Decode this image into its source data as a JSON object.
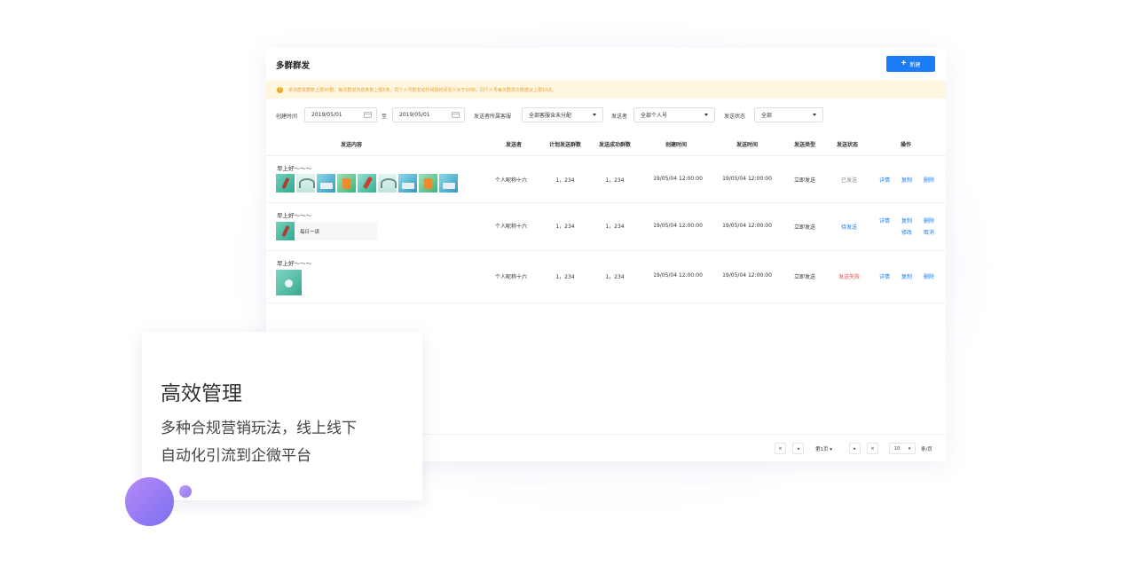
{
  "header": {
    "title": "多群群发",
    "new_button": "新建"
  },
  "notice": "单次群发群数上限30群，每次群发内容条数上限5条。同个人号群发动作间隔时间至少大于30秒，同个人号每天群发次数建议上限10次。",
  "filters": {
    "created_time_label": "创建时间",
    "start_date": "2019/05/01",
    "to_label": "至",
    "end_date": "2019/05/01",
    "service_label": "发送者所属客服",
    "service_value": "全部客服含未分配",
    "sender_label": "发送者",
    "sender_value": "全部个人号",
    "status_label": "发送状态",
    "status_value": "全部"
  },
  "table": {
    "headers": [
      "发送内容",
      "发送者",
      "计划发送群数",
      "发送成功群数",
      "创建时间",
      "发送时间",
      "发送类型",
      "发送状态",
      "操作"
    ],
    "rows": [
      {
        "greeting": "早上好～～～",
        "thumbs": [
          "mic-image",
          "wifi-image",
          "laptop-image",
          "orange-image",
          "mic-image",
          "wifi-image",
          "laptop-image",
          "orange-image",
          "laptop-image"
        ],
        "sender": "个人昵称十六",
        "planned": "1，234",
        "success": "1，234",
        "created": "19/05/04 12:00:00",
        "sent": "19/05/04 12:00:00",
        "type": "立即发送",
        "status": "已发送",
        "ops": [
          "详情",
          "复制",
          "删除"
        ]
      },
      {
        "greeting": "早上好～～～",
        "article_title": "每日一读",
        "sender": "个人昵称十六",
        "planned": "1，234",
        "success": "1，234",
        "created": "19/05/04 12:00:00",
        "sent": "19/05/04 12:00:00",
        "type": "立即发送",
        "status": "待发送",
        "ops": [
          "详情",
          "复制",
          "删除",
          "修改",
          "取消"
        ]
      },
      {
        "greeting": "早上好～～～",
        "thumbs": [
          "video-image"
        ],
        "sender": "个人昵称十六",
        "planned": "1，234",
        "success": "1，234",
        "created": "19/05/04 12:00:00",
        "sent": "19/05/04 12:00:00",
        "type": "立即发送",
        "status": "发送失败",
        "ops": [
          "详情",
          "复制",
          "删除"
        ]
      }
    ]
  },
  "pager": {
    "current": "第1页",
    "page_size": "10",
    "unit": "条/页"
  },
  "card": {
    "title": "高效管理",
    "line1": "多种合规营销玩法，线上线下",
    "line2": "自动化引流到企微平台"
  },
  "colors": {
    "accent": "#1a7df5",
    "fail": "#f04a4a",
    "notice_bg": "#fff6df",
    "notice_text": "#e9a23b",
    "ball": "#9b7cf4"
  }
}
